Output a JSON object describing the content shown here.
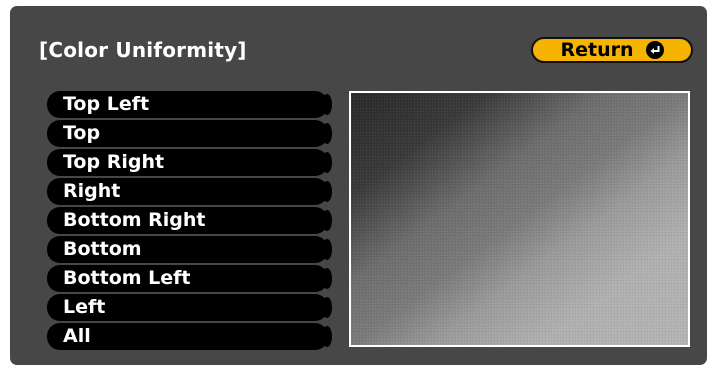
{
  "dialog": {
    "title": "[Color Uniformity]",
    "return_label": "Return",
    "return_icon": "enter-icon"
  },
  "menu": {
    "items": [
      {
        "label": "Top Left"
      },
      {
        "label": "Top"
      },
      {
        "label": "Top Right"
      },
      {
        "label": "Right"
      },
      {
        "label": "Bottom Right"
      },
      {
        "label": "Bottom"
      },
      {
        "label": "Bottom Left"
      },
      {
        "label": "Left"
      },
      {
        "label": "All"
      }
    ]
  },
  "colors": {
    "panel_bg": "#474747",
    "menu_item_bg": "#000000",
    "button_accent": "#f6b400",
    "text": "#ffffff",
    "preview_dark": "#2f2f2f",
    "preview_light": "#b2b2b2"
  }
}
